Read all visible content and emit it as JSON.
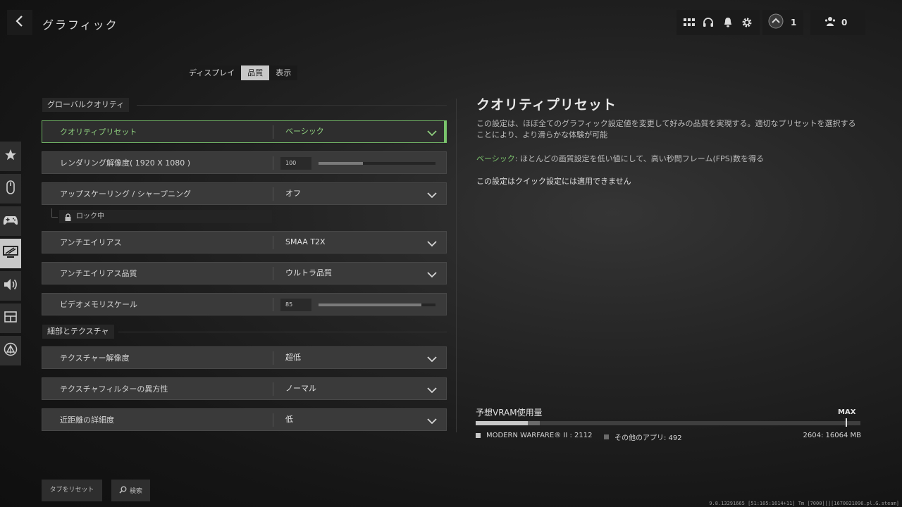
{
  "header": {
    "title": "グラフィック",
    "rank_count": "1",
    "friends_count": "0",
    "icons": [
      "back-chevron-icon",
      "grid-apps-icon",
      "headset-icon",
      "bell-icon",
      "gear-icon",
      "rank-emblem-icon",
      "friends-icon"
    ]
  },
  "tabs": [
    {
      "label": "ディスプレイ",
      "active": false
    },
    {
      "label": "品質",
      "active": true
    },
    {
      "label": "表示",
      "active": false
    }
  ],
  "side_nav": [
    "star-icon",
    "mouse-icon",
    "gamepad-icon",
    "monitor-icon",
    "speaker-icon",
    "interface-icon",
    "network-icon"
  ],
  "sections": {
    "global": {
      "title": "グローバルクオリティ",
      "rows": [
        {
          "label": "クオリティプリセット",
          "value": "ベーシック"
        },
        {
          "label": "レンダリング解像度( 1920 X 1080 )",
          "value": "100",
          "slider_fraction": 0.38
        },
        {
          "label": "アップスケーリング / シャープニング",
          "value": "オフ"
        },
        {
          "label": "アンチエイリアス",
          "value": "SMAA T2X"
        },
        {
          "label": "アンチエイリアス品質",
          "value": "ウルトラ品質"
        },
        {
          "label": "ビデオメモリスケール",
          "value": "85",
          "slider_fraction": 0.88
        }
      ],
      "locked_label": "ロック中"
    },
    "detail": {
      "title": "細部とテクスチャ",
      "rows": [
        {
          "label": "テクスチャー解像度",
          "value": "超低"
        },
        {
          "label": "テクスチャフィルターの異方性",
          "value": "ノーマル"
        },
        {
          "label": "近距離の詳細度",
          "value": "低"
        }
      ]
    }
  },
  "description": {
    "title": "クオリティプリセット",
    "text": "この設定は、ほぼ全てのグラフィック設定値を変更して好みの品質を実現する。適切なプリセットを選択することにより、より滑らかな体験が可能",
    "preset_name": "ベーシック",
    "preset_text": ": ほとんどの画質設定を低い値にして、高い秒間フレーム(FPS)数を得る",
    "note": "この設定はクイック設定には適用できません"
  },
  "vram": {
    "label": "予想VRAM使用量",
    "max_label": "MAX",
    "mw_label": "MODERN WARFARE® II : 2112",
    "other_label": "その他のアプリ: 492",
    "total_label": "2604: 16064 MB",
    "mw_mb": 2112,
    "other_mb": 492,
    "total_mb": 16064,
    "colors": {
      "mw": "#c8c8c8",
      "other": "#6a6a6a"
    }
  },
  "footer": {
    "reset_label": "タブをリセット",
    "search_label": "検索",
    "build": "9.8.13291665 [51:105:1614+11] Tm [7000][][1670021096.pl.G.steam]"
  },
  "colors": {
    "accent": "#79c46c"
  }
}
